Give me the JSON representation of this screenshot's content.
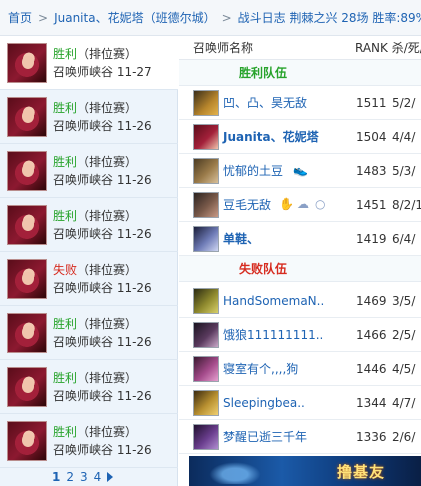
{
  "breadcrumb": {
    "home": "首页",
    "player": "Juanita、花妮塔（班德尔城）",
    "current": "战斗日志 荆棘之兴 28场 胜率:89%"
  },
  "matches": [
    {
      "result": "胜利",
      "type": "（排位赛）",
      "map_date": "召唤师峡谷 11-27",
      "status": "win"
    },
    {
      "result": "胜利",
      "type": "（排位赛）",
      "map_date": "召唤师峡谷 11-26",
      "status": "win"
    },
    {
      "result": "胜利",
      "type": "（排位赛）",
      "map_date": "召唤师峡谷 11-26",
      "status": "win"
    },
    {
      "result": "胜利",
      "type": "（排位赛）",
      "map_date": "召唤师峡谷 11-26",
      "status": "win"
    },
    {
      "result": "失败",
      "type": "（排位赛）",
      "map_date": "召唤师峡谷 11-26",
      "status": "loss"
    },
    {
      "result": "胜利",
      "type": "（排位赛）",
      "map_date": "召唤师峡谷 11-26",
      "status": "win"
    },
    {
      "result": "胜利",
      "type": "（排位赛）",
      "map_date": "召唤师峡谷 11-26",
      "status": "win"
    },
    {
      "result": "胜利",
      "type": "（排位赛）",
      "map_date": "召唤师峡谷 11-26",
      "status": "win"
    }
  ],
  "pagination": {
    "pages": [
      "1",
      "2",
      "3",
      "4"
    ],
    "current": "1"
  },
  "columns": {
    "name": "召唤师名称",
    "rank_kda": "RANK 杀/死/"
  },
  "winning_team": {
    "label": "胜利队伍",
    "players": [
      {
        "name": "凹、凸、昊无敌",
        "rank": "1511",
        "kda": "5/2/"
      },
      {
        "name": "Juanita、花妮塔",
        "rank": "1504",
        "kda": "4/4/"
      },
      {
        "name": "忧郁的土豆",
        "rank": "1483",
        "kda": "5/3/"
      },
      {
        "name": "豆毛无敌",
        "rank": "1451",
        "kda": "8/2/1"
      },
      {
        "name": "单鞋、",
        "rank": "1419",
        "kda": "6/4/"
      }
    ]
  },
  "losing_team": {
    "label": "失败队伍",
    "players": [
      {
        "name": "HandSomemaN..",
        "rank": "1469",
        "kda": "3/5/"
      },
      {
        "name": "饿狼111111111..",
        "rank": "1466",
        "kda": "2/5/"
      },
      {
        "name": "寝室有个,,,,狗",
        "rank": "1446",
        "kda": "4/5/"
      },
      {
        "name": "Sleepingbea..",
        "rank": "1344",
        "kda": "4/7/"
      },
      {
        "name": "梦醒已逝三千年",
        "rank": "1336",
        "kda": "2/6/"
      }
    ]
  },
  "banner": {
    "text": "撸基友"
  },
  "icons": {
    "breadcrumb_separator": "chevron-right-icon",
    "pager_next": "triangle-right-icon",
    "honor_icons": [
      "boot-icon",
      "hand-icon",
      "cloud-icon",
      "circle-icon"
    ]
  },
  "colors": {
    "win": "#27a32b",
    "loss": "#d62b1f",
    "link": "#1e63b3"
  }
}
